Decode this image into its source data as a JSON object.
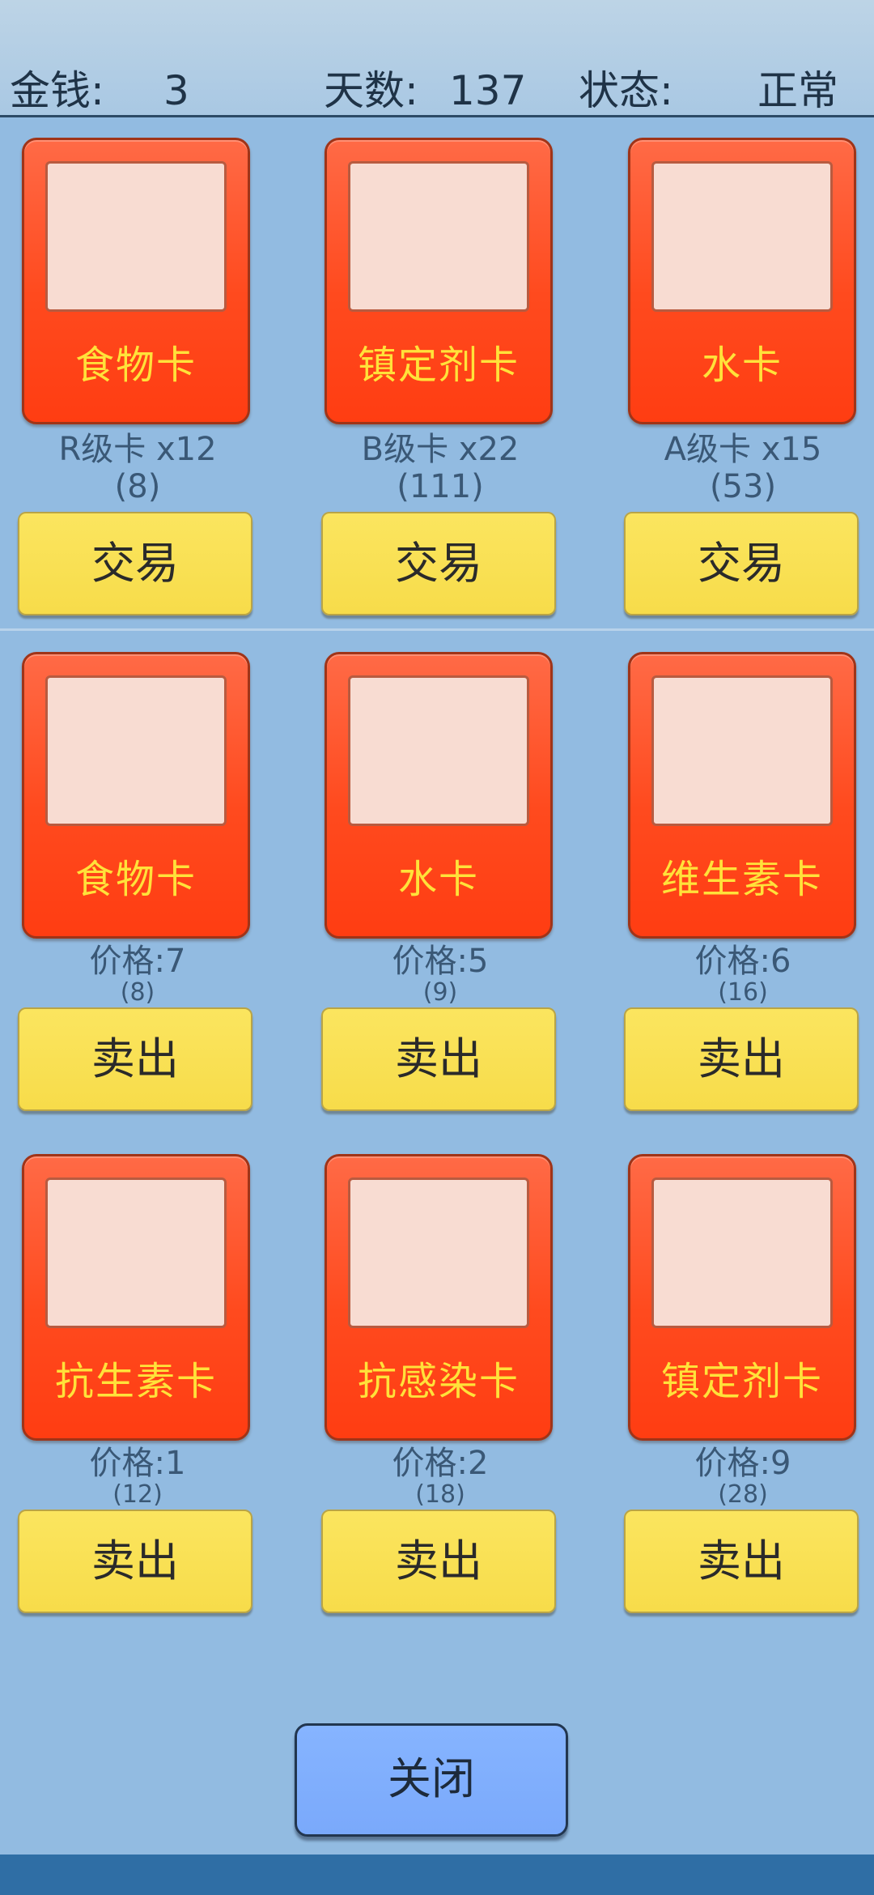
{
  "header": {
    "money_label": "金钱:",
    "money_value": "3",
    "day_label": "天数:",
    "day_value": "137",
    "status_label": "状态:",
    "status_value": "正常"
  },
  "trade_cards": [
    {
      "name": "食物卡",
      "grade": "R级卡 x12",
      "count": "(8)",
      "button": "交易"
    },
    {
      "name": "镇定剂卡",
      "grade": "B级卡 x22",
      "count": "(111)",
      "button": "交易"
    },
    {
      "name": "水卡",
      "grade": "A级卡 x15",
      "count": "(53)",
      "button": "交易"
    }
  ],
  "sell_cards": [
    {
      "name": "食物卡",
      "price": "价格:7",
      "count": "(8)",
      "button": "卖出"
    },
    {
      "name": "水卡",
      "price": "价格:5",
      "count": "(9)",
      "button": "卖出"
    },
    {
      "name": "维生素卡",
      "price": "价格:6",
      "count": "(16)",
      "button": "卖出"
    },
    {
      "name": "抗生素卡",
      "price": "价格:1",
      "count": "(12)",
      "button": "卖出"
    },
    {
      "name": "抗感染卡",
      "price": "价格:2",
      "count": "(18)",
      "button": "卖出"
    },
    {
      "name": "镇定剂卡",
      "price": "价格:9",
      "count": "(28)",
      "button": "卖出"
    }
  ],
  "close_button": "关闭",
  "colors": {
    "background": "#92bbe1",
    "card": "#ff4a1e",
    "card_name": "#ffe23a",
    "button": "#f7dc4a",
    "close_button": "#7aa9fb"
  }
}
